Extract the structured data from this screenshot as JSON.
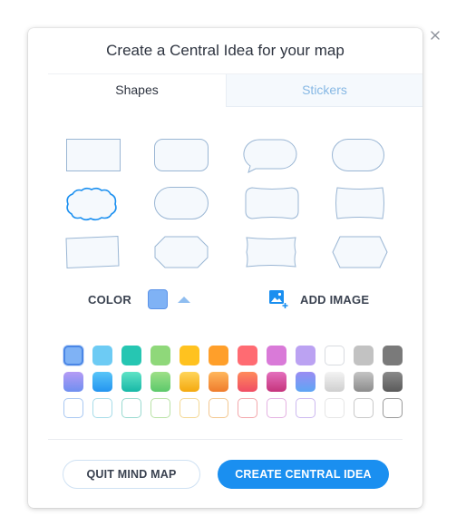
{
  "dialog": {
    "title": "Create a Central Idea for your map",
    "tabs": [
      {
        "label": "Shapes",
        "active": true
      },
      {
        "label": "Stickers",
        "active": false
      }
    ],
    "color_label": "COLOR",
    "add_image_label": "ADD IMAGE",
    "quit_button": "QUIT MIND MAP",
    "create_button": "CREATE CENTRAL IDEA"
  },
  "shapes": [
    "rectangle",
    "rounded-rectangle",
    "speech-bubble",
    "ellipse",
    "cloud",
    "pill",
    "soft-rectangle",
    "barrel",
    "tilted-rectangle",
    "cut-corner-pill",
    "wave-rectangle",
    "hexagon"
  ],
  "selected_shape": "cloud",
  "selected_color": "#7fb2f5",
  "palette": [
    [
      "#7fb2f5",
      "#6dcbf4",
      "#26c6b2",
      "#8fd87a",
      "#ffc21f",
      "#ff9f2a",
      "#ff6b72",
      "#d97ad8",
      "#bba2f2",
      "#ffffff",
      "#c2c2c2",
      "#7a7a7a"
    ],
    [
      "gradient-purple",
      "gradient-blue",
      "gradient-teal",
      "gradient-green",
      "gradient-yellow",
      "gradient-orange",
      "gradient-red",
      "gradient-magenta",
      "gradient-violet",
      "gradient-silver",
      "gradient-gray",
      "gradient-dark"
    ],
    [
      "#a9c8f2",
      "#a7dce9",
      "#9adad0",
      "#b9e2a6",
      "#f4d894",
      "#f3c790",
      "#f3a7ab",
      "#e4b2e2",
      "#cdb9f0",
      "#e6e6e6",
      "#c9c9c9",
      "#9a9a9a"
    ]
  ],
  "colors": {
    "accent": "#1a8ff0",
    "shape_stroke": "#9ab6d4",
    "shape_fill": "#f5f9fd",
    "selected_stroke": "#1a8ff0"
  }
}
